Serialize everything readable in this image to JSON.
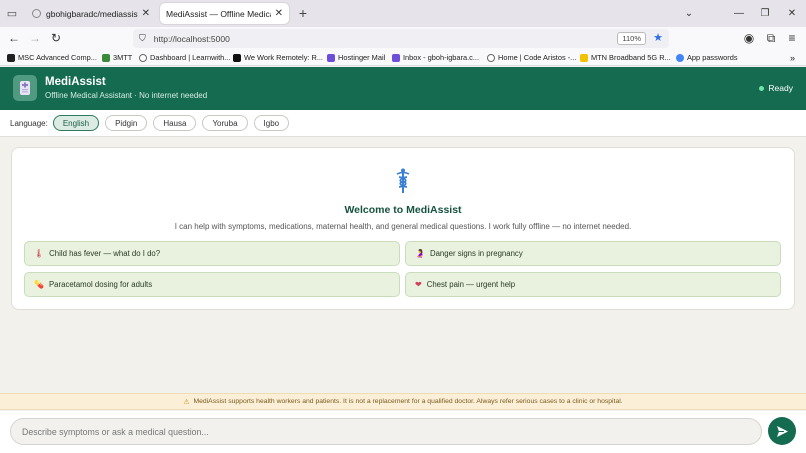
{
  "browser": {
    "tabs": [
      {
        "title": "gbohigbaradc/mediassist_subm",
        "active": false
      },
      {
        "title": "MediAssist — Offline Medical Assist",
        "active": true
      }
    ],
    "new_tab": "+",
    "url": "http://localhost:5000",
    "zoom": "110%",
    "bookmarks": [
      {
        "label": "MSC Advanced Comp...",
        "color": "#222222"
      },
      {
        "label": "3MTT",
        "color": "#3a8a3a"
      },
      {
        "label": "Dashboard | Learnwith...",
        "color": "#666666"
      },
      {
        "label": "We Work Remotely: R...",
        "color": "#111111"
      },
      {
        "label": "Hostinger Mail",
        "color": "#6b4fd8"
      },
      {
        "label": "Inbox - gboh-igbara.c...",
        "color": "#6b4fd8"
      },
      {
        "label": "Home | Code Aristos -...",
        "color": "#666666"
      },
      {
        "label": "MTN Broadband 5G R...",
        "color": "#f2c200"
      },
      {
        "label": "App passwords",
        "color": "#4285f4"
      }
    ]
  },
  "app": {
    "name": "MediAssist",
    "subtitle": "Offline Medical Assistant · No internet needed",
    "status": "Ready",
    "brand_color": "#146b50"
  },
  "language": {
    "label": "Language:",
    "options": [
      "English",
      "Pidgin",
      "Hausa",
      "Yoruba",
      "Igbo"
    ],
    "selected": "English"
  },
  "welcome": {
    "icon": "caduceus-icon",
    "title": "Welcome to MediAssist",
    "text": "I can help with symptoms, medications, maternal health, and general medical questions. I work fully offline — no internet needed."
  },
  "suggestions": [
    {
      "icon": "thermometer-icon",
      "glyph": "🌡",
      "label": "Child has fever — what do I do?"
    },
    {
      "icon": "pregnant-woman-icon",
      "glyph": "🤰",
      "label": "Danger signs in pregnancy"
    },
    {
      "icon": "pill-icon",
      "glyph": "💊",
      "label": "Paracetamol dosing for adults"
    },
    {
      "icon": "heart-icon",
      "glyph": "❤",
      "label": "Chest pain — urgent help"
    }
  ],
  "disclaimer": "MediAssist supports health workers and patients. It is not a replacement for a qualified doctor. Always refer serious cases to a clinic or hospital.",
  "composer": {
    "placeholder": "Describe symptoms or ask a medical question..."
  }
}
